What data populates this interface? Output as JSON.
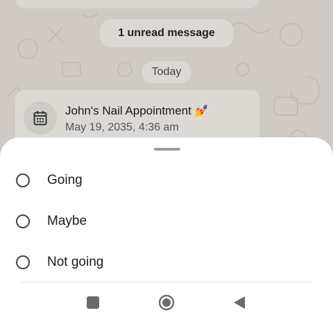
{
  "chat": {
    "unread_label": "1 unread message",
    "date_label": "Today",
    "event": {
      "title": "John's Nail Appointment",
      "emoji": "💅",
      "datetime": "May 19, 2035, 4:36 am",
      "icon": "calendar-icon"
    }
  },
  "sheet": {
    "options": [
      {
        "label": "Going",
        "selected": false
      },
      {
        "label": "Maybe",
        "selected": false
      },
      {
        "label": "Not going",
        "selected": false
      }
    ]
  },
  "navbar": {
    "recents_icon": "square-icon",
    "home_icon": "circle-home-icon",
    "back_icon": "triangle-back-icon"
  },
  "colors": {
    "wallpaper": "#cfcac4",
    "chip_bg": "#dcd9d5",
    "sheet_bg": "#ffffff",
    "radio_border": "#444444"
  }
}
